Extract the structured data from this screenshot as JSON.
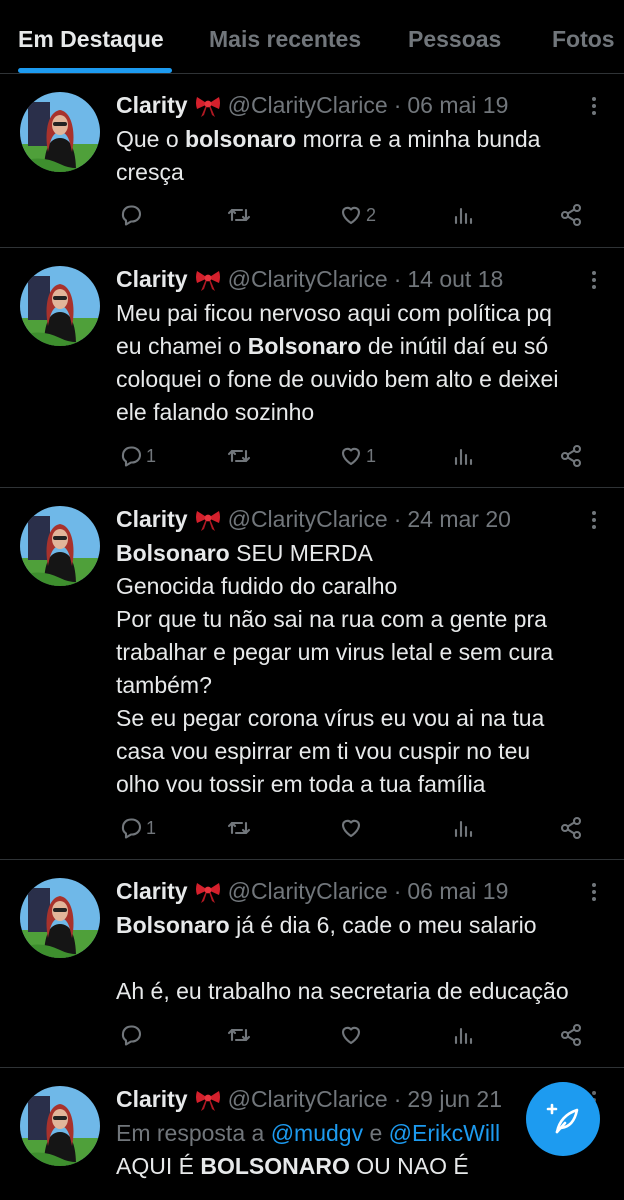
{
  "tabs": [
    "Em Destaque",
    "Mais recentes",
    "Pessoas",
    "Fotos"
  ],
  "active_tab": "Em Destaque",
  "colors": {
    "accent": "#1d9bf0",
    "muted": "#71767b",
    "text": "#e7e9ea",
    "background": "#000000",
    "divider": "#2f3336"
  },
  "icons": [
    "ribbon-bow-emoji",
    "more-vertical-icon",
    "reply-icon",
    "retweet-icon",
    "like-icon",
    "views-icon",
    "share-icon",
    "compose-post-icon"
  ],
  "tweets": [
    {
      "name": "Clarity",
      "handle": "@ClarityClarice",
      "sep": "·",
      "date": "06 mai 19",
      "lines": [
        {
          "bold": "",
          "text": "Que o ",
          "bold2": "bolsonaro",
          "text2": " morra e a minha bunda"
        },
        {
          "text": "cresça"
        }
      ],
      "replies": "",
      "retweets": "",
      "likes": "2",
      "views": ""
    },
    {
      "name": "Clarity",
      "handle": "@ClarityClarice",
      "sep": "·",
      "date": "14 out 18",
      "lines": [
        {
          "text": "Meu pai ficou nervoso aqui com política pq"
        },
        {
          "text": "eu chamei o ",
          "bold2": "Bolsonaro",
          "text2": " de inútil daí eu só"
        },
        {
          "text": "coloquei o fone de ouvido bem alto e deixei"
        },
        {
          "text": "ele falando sozinho"
        }
      ],
      "replies": "1",
      "retweets": "",
      "likes": "1",
      "views": ""
    },
    {
      "name": "Clarity",
      "handle": "@ClarityClarice",
      "sep": "·",
      "date": "24 mar 20",
      "lines": [
        {
          "bold": "Bolsonaro",
          "text": " SEU MERDA"
        },
        {
          "text": "Genocida fudido do caralho"
        },
        {
          "text": "Por que tu não sai na rua com a gente pra"
        },
        {
          "text": "trabalhar e pegar um virus letal e sem cura"
        },
        {
          "text": "também?"
        },
        {
          "text": "Se eu pegar corona vírus eu vou ai na tua"
        },
        {
          "text": "casa vou espirrar em ti vou cuspir no teu"
        },
        {
          "text": "olho vou tossir em toda a tua família"
        }
      ],
      "replies": "1",
      "retweets": "",
      "likes": "",
      "views": ""
    },
    {
      "name": "Clarity",
      "handle": "@ClarityClarice",
      "sep": "·",
      "date": "06 mai 19",
      "lines": [
        {
          "bold": "Bolsonaro",
          "text": " já é dia 6, cade o meu salario"
        },
        {
          "text": ""
        },
        {
          "text": "Ah é, eu trabalho na secretaria de educação"
        }
      ],
      "replies": "",
      "retweets": "",
      "likes": "",
      "views": ""
    },
    {
      "name": "Clarity",
      "handle": "@ClarityClarice",
      "sep": "·",
      "date": "29 jun 21",
      "reply_prefix": "Em resposta a ",
      "reply_to_1": "@mudgv",
      "reply_and": " e ",
      "reply_to_2": "@ErikcWill",
      "lines": [
        {
          "text": "AQUI É ",
          "bold2": "BOLSONARO",
          "text2": " OU NAO É"
        }
      ],
      "replies": "",
      "retweets": "",
      "likes": "",
      "views": ""
    }
  ]
}
